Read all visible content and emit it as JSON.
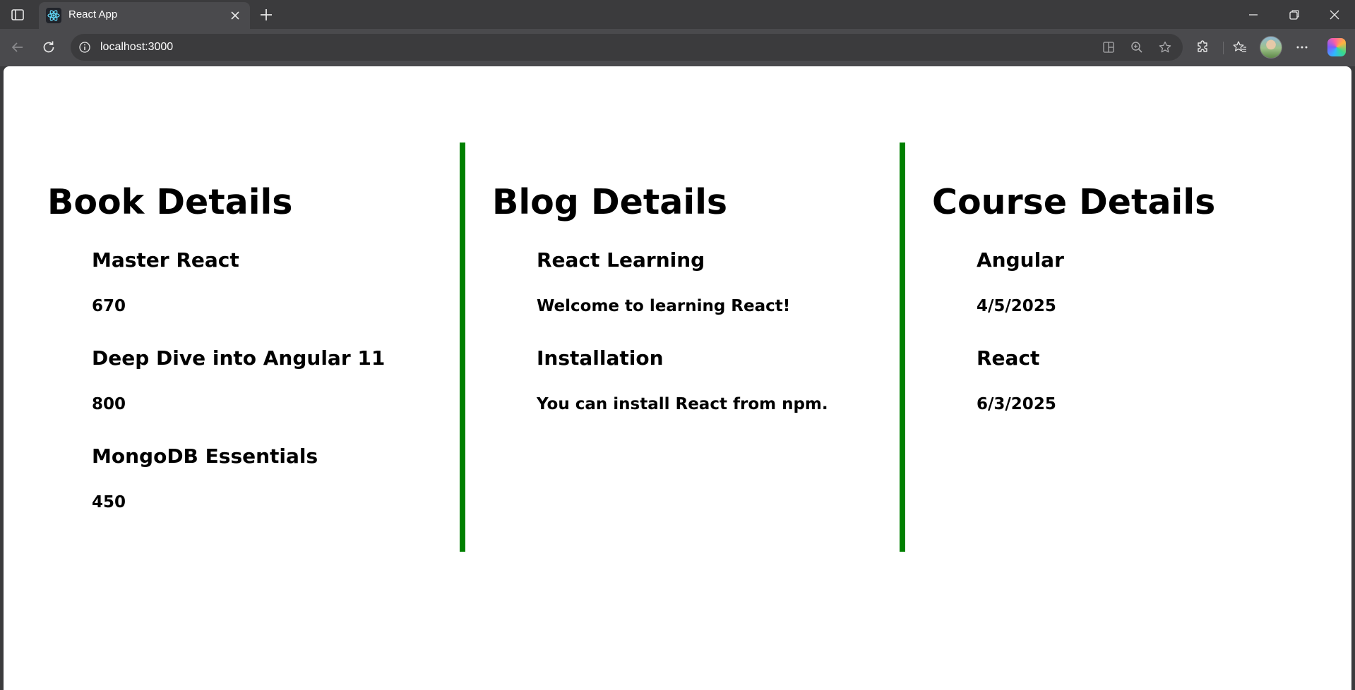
{
  "browser": {
    "tab": {
      "title": "React App"
    },
    "address_bar": {
      "url": "localhost:3000"
    },
    "icons": {
      "sidebar": "sidebar-icon",
      "favicon": "react-icon",
      "tab_close": "close-icon",
      "new_tab": "plus-icon",
      "back": "back-arrow-icon",
      "reload": "reload-icon",
      "site_info": "info-icon",
      "split": "split-screen-icon",
      "zoom": "zoom-icon",
      "favorite": "star-icon",
      "extensions": "puzzle-icon",
      "favorites": "favorites-icon",
      "more": "more-icon",
      "copilot": "copilot-icon"
    }
  },
  "page": {
    "accent_color": "#008000",
    "book": {
      "heading": "Book Details",
      "items": [
        {
          "name": "Master React",
          "value": "670"
        },
        {
          "name": "Deep Dive into Angular 11",
          "value": "800"
        },
        {
          "name": "MongoDB Essentials",
          "value": "450"
        }
      ]
    },
    "blog": {
      "heading": "Blog Details",
      "items": [
        {
          "name": "React Learning",
          "value": "Welcome to learning React!"
        },
        {
          "name": "Installation",
          "value": "You can install React from npm."
        }
      ]
    },
    "course": {
      "heading": "Course Details",
      "items": [
        {
          "name": "Angular",
          "value": "4/5/2025"
        },
        {
          "name": "React",
          "value": "6/3/2025"
        }
      ]
    }
  }
}
